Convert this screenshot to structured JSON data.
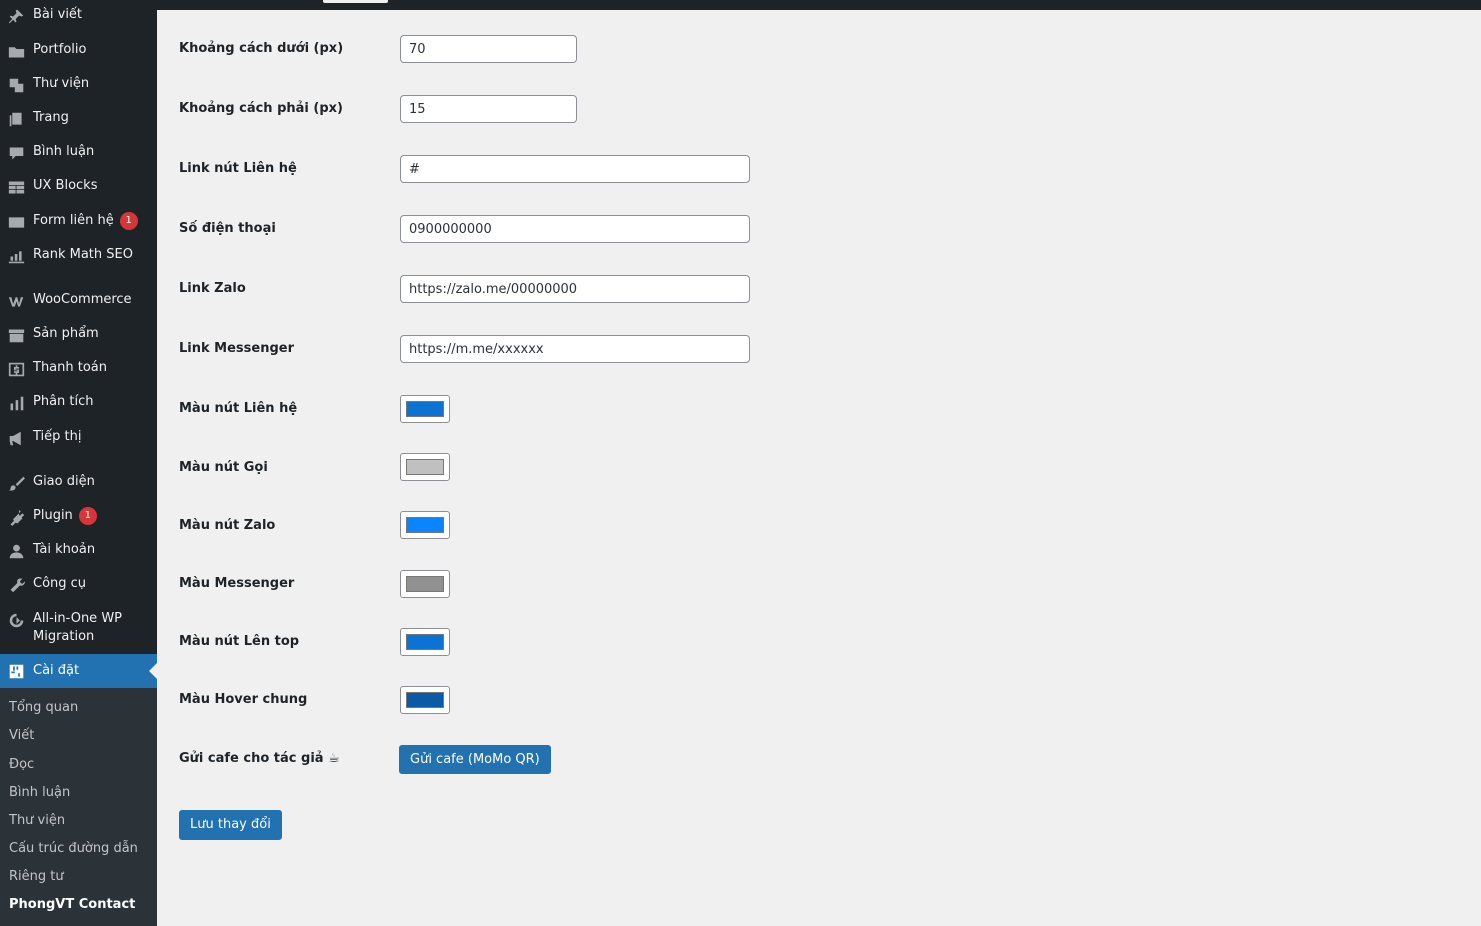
{
  "menu": {
    "items": [
      {
        "label": "Bài viết",
        "icon": "pin-icon"
      },
      {
        "label": "Portfolio",
        "icon": "folder-icon"
      },
      {
        "label": "Thư viện",
        "icon": "media-icon"
      },
      {
        "label": "Trang",
        "icon": "pages-icon"
      },
      {
        "label": "Bình luận",
        "icon": "comment-icon"
      },
      {
        "label": "UX Blocks",
        "icon": "grid-icon"
      },
      {
        "label": "Form liên hệ",
        "icon": "mail-icon",
        "badge": "1"
      },
      {
        "label": "Rank Math SEO",
        "icon": "chart-icon"
      },
      {
        "label": "WooCommerce",
        "icon": "woo-icon"
      },
      {
        "label": "Sản phẩm",
        "icon": "archive-icon"
      },
      {
        "label": "Thanh toán",
        "icon": "dollar-icon"
      },
      {
        "label": "Phân tích",
        "icon": "bar-chart-icon"
      },
      {
        "label": "Tiếp thị",
        "icon": "megaphone-icon"
      },
      {
        "label": "Giao diện",
        "icon": "brush-icon"
      },
      {
        "label": "Plugin",
        "icon": "plug-icon",
        "badge": "1"
      },
      {
        "label": "Tài khoản",
        "icon": "user-icon"
      },
      {
        "label": "Công cụ",
        "icon": "wrench-icon"
      },
      {
        "label": "All-in-One WP Migration",
        "icon": "migration-icon"
      },
      {
        "label": "Cài đặt",
        "icon": "settings-icon"
      }
    ],
    "submenu": [
      "Tổng quan",
      "Viết",
      "Đọc",
      "Bình luận",
      "Thư viện",
      "Cấu trúc đường dẫn",
      "Riêng tư",
      "PhongVT Contact"
    ]
  },
  "form": {
    "fields": [
      {
        "label": "Khoảng cách dưới (px)",
        "value": "70"
      },
      {
        "label": "Khoảng cách phải (px)",
        "value": "15"
      },
      {
        "label": "Link nút Liên hệ",
        "value": "#"
      },
      {
        "label": "Số điện thoại",
        "value": "0900000000"
      },
      {
        "label": "Link Zalo",
        "value": "https://zalo.me/00000000"
      },
      {
        "label": "Link Messenger",
        "value": "https://m.me/xxxxxx"
      }
    ],
    "colors": [
      {
        "label": "Màu nút Liên hệ",
        "color": "#0a73d4"
      },
      {
        "label": "Màu nút Gọi",
        "color": "#c0c0c0"
      },
      {
        "label": "Màu nút Zalo",
        "color": "#0a84ff"
      },
      {
        "label": "Màu Messenger",
        "color": "#909090"
      },
      {
        "label": "Màu nút Lên top",
        "color": "#0a73d4"
      },
      {
        "label": "Màu Hover chung",
        "color": "#0a5aa8"
      }
    ],
    "coffee_label": "Gửi cafe cho tác giả ☕",
    "coffee_button": "Gửi cafe (MoMo QR)",
    "save_button": "Lưu thay đổi"
  }
}
